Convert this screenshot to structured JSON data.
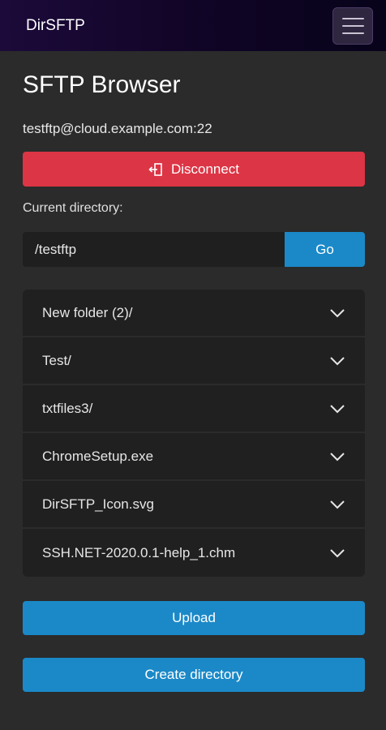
{
  "navbar": {
    "brand": "DirSFTP"
  },
  "page": {
    "title": "SFTP Browser"
  },
  "connection": {
    "label": "testftp@cloud.example.com:22"
  },
  "actions": {
    "disconnect": "Disconnect",
    "upload": "Upload",
    "create_directory": "Create directory",
    "go": "Go"
  },
  "directory": {
    "label": "Current directory:",
    "path": "/testftp"
  },
  "files": [
    {
      "name": "New folder (2)/"
    },
    {
      "name": "Test/"
    },
    {
      "name": "txtfiles3/"
    },
    {
      "name": "ChromeSetup.exe"
    },
    {
      "name": "DirSFTP_Icon.svg"
    },
    {
      "name": "SSH.NET-2020.0.1-help_1.chm"
    }
  ],
  "colors": {
    "danger": "#dc3545",
    "primary": "#1b89c8",
    "background": "#2b2b2b"
  },
  "icons": {
    "disconnect": "door-exit-icon",
    "expand": "chevron-down-icon",
    "menu": "hamburger-menu-icon"
  }
}
